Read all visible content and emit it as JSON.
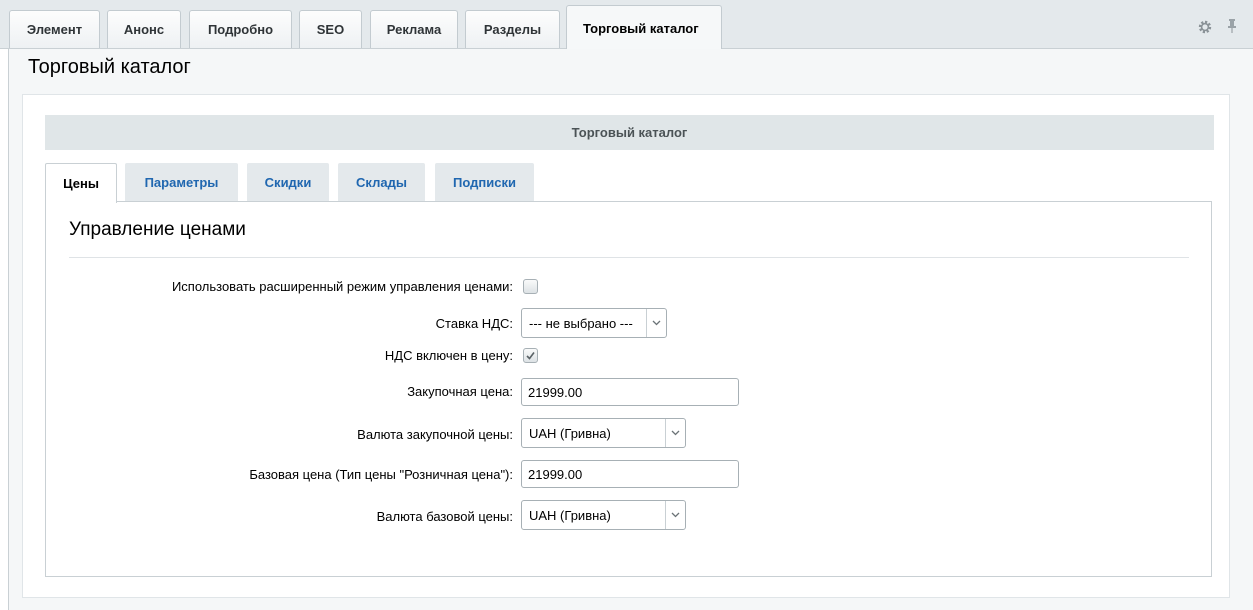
{
  "top_tabs": [
    "Элемент",
    "Анонс",
    "Подробно",
    "SEO",
    "Реклама",
    "Разделы",
    "Торговый каталог"
  ],
  "page_title": "Торговый каталог",
  "section_header": "Торговый каталог",
  "inner_tabs": [
    "Цены",
    "Параметры",
    "Скидки",
    "Склады",
    "Подписки"
  ],
  "subsection_title": "Управление ценами",
  "form": {
    "extended_mode": {
      "label": "Использовать расширенный режим управления ценами:",
      "checked": false
    },
    "vat_rate": {
      "label": "Ставка НДС:",
      "value": "--- не выбрано ---"
    },
    "vat_included": {
      "label": "НДС включен в цену:",
      "checked": true
    },
    "purchase_price": {
      "label": "Закупочная цена:",
      "value": "21999.00"
    },
    "purchase_currency": {
      "label": "Валюта закупочной цены:",
      "value": "UAH (Гривна)"
    },
    "base_price": {
      "label": "Базовая цена (Тип цены \"Розничная цена\"):",
      "value": "21999.00"
    },
    "base_currency": {
      "label": "Валюта базовой цены:",
      "value": "UAH (Гривна)"
    }
  },
  "colors": {
    "tab_bar_bg": "#e4e9ec",
    "link_blue": "#2067b0",
    "section_header_bg": "#e0e6e8"
  }
}
